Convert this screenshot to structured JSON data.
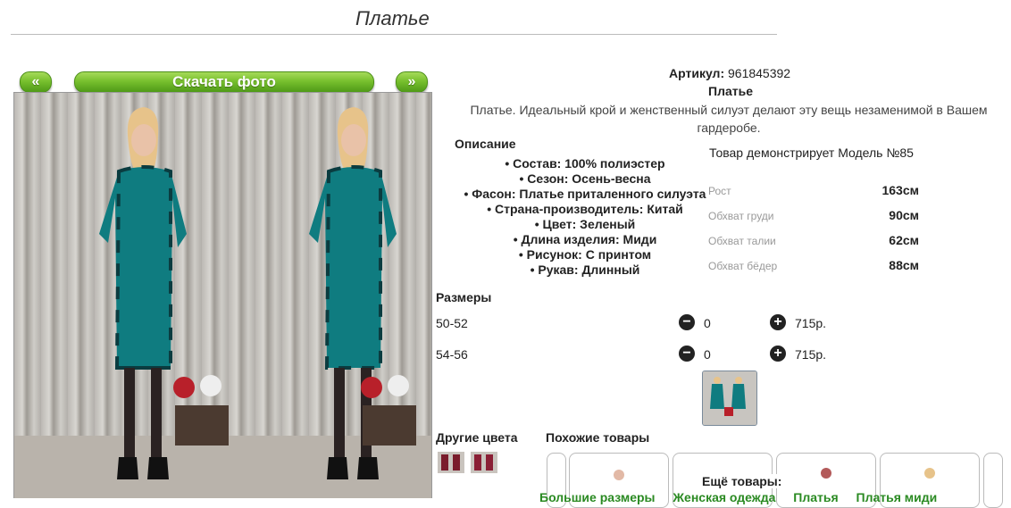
{
  "page": {
    "title": "Платье"
  },
  "gallery": {
    "prev_label": "«",
    "download_label": "Скачать фото",
    "next_label": "»"
  },
  "product": {
    "article_label": "Артикул:",
    "article_value": "961845392",
    "name": "Платье",
    "description": "Платье. Идеальный крой и женственный силуэт делают эту вещь незаменимой в Вашем гардеробе."
  },
  "specs": {
    "heading": "Описание",
    "items": [
      "• Состав: 100% полиэстер",
      "• Сезон: Осень-весна",
      "• Фасон: Платье приталенного силуэта",
      "• Страна-производитель: Китай",
      "• Цвет: Зеленый",
      "• Длина изделия: Миди",
      "• Рисунок: С принтом",
      "• Рукав: Длинный"
    ]
  },
  "model": {
    "text": "Товар демонстрирует Модель №85",
    "params": [
      {
        "label": "Рост",
        "value": "163см"
      },
      {
        "label": "Обхват груди",
        "value": "90см"
      },
      {
        "label": "Обхват талии",
        "value": "62см"
      },
      {
        "label": "Обхват бёдер",
        "value": "88см"
      }
    ]
  },
  "sizes": {
    "heading": "Размеры",
    "rows": [
      {
        "size": "50-52",
        "minus": "−",
        "qty": "0",
        "plus": "+",
        "price": "715р."
      },
      {
        "size": "54-56",
        "minus": "−",
        "qty": "0",
        "plus": "+",
        "price": "715р."
      }
    ]
  },
  "related": {
    "other_colors": "Другие цвета",
    "similar": "Похожие товары",
    "more_heading": "Ещё товары:",
    "more_links": [
      "Большие размеры",
      "Женская одежда",
      "Платья",
      "Платья миди"
    ]
  },
  "colors": {
    "accent": "#78c02e",
    "dress_teal": "#0f7c80",
    "link_green": "#2a8a22"
  },
  "icons": {
    "minus": "minus-circle-icon",
    "plus": "plus-circle-icon"
  }
}
